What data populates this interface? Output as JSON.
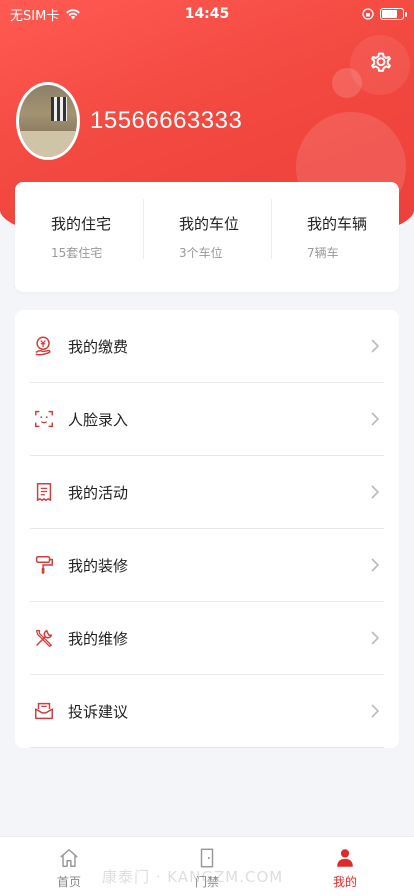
{
  "status_bar": {
    "carrier": "无SIM卡",
    "time": "14:45"
  },
  "profile": {
    "phone": "15566663333"
  },
  "summary": [
    {
      "title": "我的住宅",
      "sub": "15套住宅"
    },
    {
      "title": "我的车位",
      "sub": "3个车位"
    },
    {
      "title": "我的车辆",
      "sub": "7辆车"
    }
  ],
  "menu": [
    {
      "label": "我的缴费",
      "icon": "payment-icon"
    },
    {
      "label": "人脸录入",
      "icon": "face-scan-icon"
    },
    {
      "label": "我的活动",
      "icon": "receipt-icon"
    },
    {
      "label": "我的装修",
      "icon": "paint-roller-icon"
    },
    {
      "label": "我的维修",
      "icon": "tools-icon"
    },
    {
      "label": "投诉建议",
      "icon": "feedback-icon"
    }
  ],
  "tabbar": [
    {
      "label": "首页",
      "icon": "home-icon"
    },
    {
      "label": "门禁",
      "icon": "door-icon"
    },
    {
      "label": "我的",
      "icon": "person-icon"
    }
  ],
  "watermark": "康泰门 · KANGZM.COM",
  "colors": {
    "accent": "#ee3f3a",
    "active_tab": "#e02a2a"
  }
}
